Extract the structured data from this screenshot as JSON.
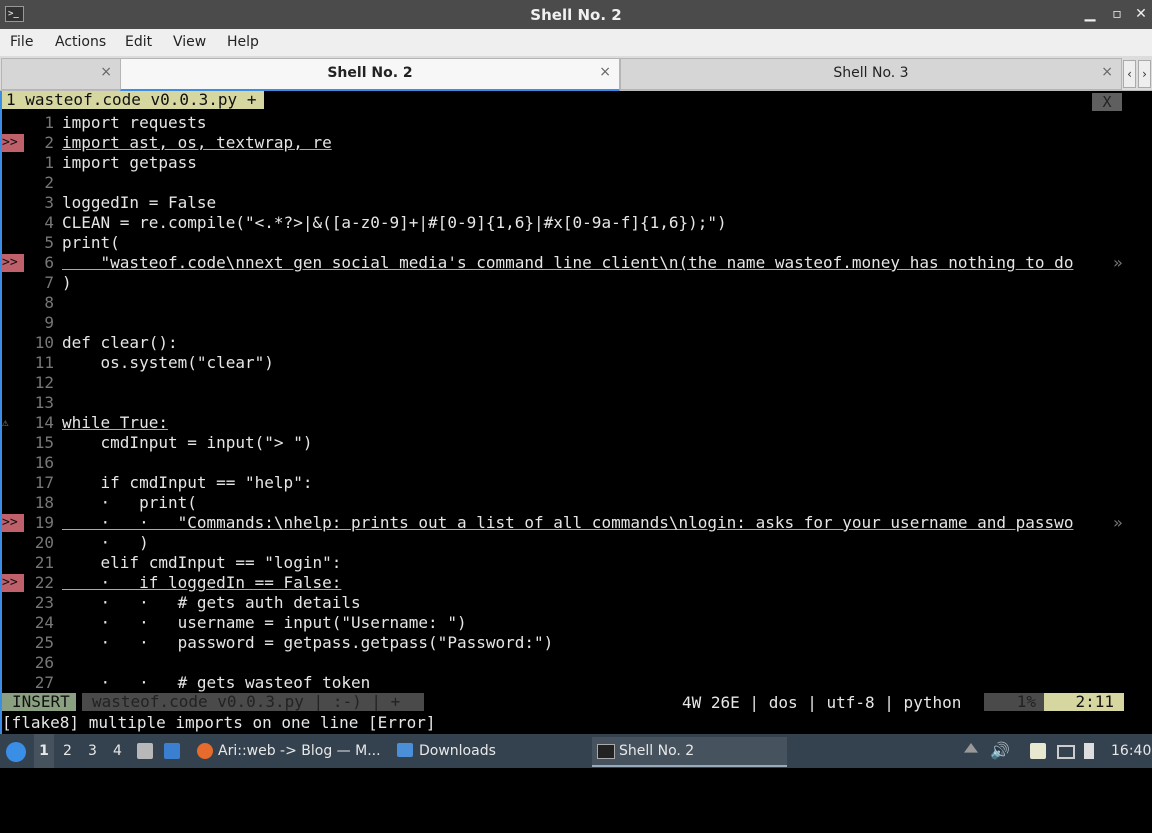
{
  "window": {
    "title": "Shell No. 2",
    "icon": "terminal-icon"
  },
  "menu": [
    "File",
    "Actions",
    "Edit",
    "View",
    "Help"
  ],
  "tabs": [
    {
      "label": "",
      "close": "×"
    },
    {
      "label": "Shell No. 2",
      "close": "×"
    },
    {
      "label": "Shell No. 3",
      "close": "×"
    }
  ],
  "tab_nav": {
    "prev": "‹",
    "next": "›"
  },
  "vim": {
    "tab_label": "1 wasteof.code v0.0.3.py +",
    "close_label": "X",
    "mode": "INSERT",
    "file": "wasteof.code v0.0.3.py | :-) | +",
    "status_right": "4W 26E | dos | utf-8 | python",
    "percent": "1%",
    "position": "2:11",
    "message": "[flake8] multiple imports on one line [Error]"
  },
  "code_lines": [
    {
      "num": "1",
      "sign": "",
      "text": "import requests"
    },
    {
      "num": "2",
      "sign": ">>",
      "text": "import ast, os, textwrap, re"
    },
    {
      "num": "1",
      "sign": "",
      "text": "import getpass"
    },
    {
      "num": "2",
      "sign": "",
      "text": ""
    },
    {
      "num": "3",
      "sign": "",
      "text": "loggedIn = False"
    },
    {
      "num": "4",
      "sign": "",
      "text": "CLEAN = re.compile(\"<.*?>|&([a-z0-9]+|#[0-9]{1,6}|#x[0-9a-f]{1,6});\")"
    },
    {
      "num": "5",
      "sign": "",
      "text": "print("
    },
    {
      "num": "6",
      "sign": ">>",
      "text": "    \"wasteof.code\\nnext gen social media's command line client\\n(the name wasteof.money has nothing to do"
    },
    {
      "num": "7",
      "sign": "",
      "text": ")"
    },
    {
      "num": "8",
      "sign": "",
      "text": ""
    },
    {
      "num": "9",
      "sign": "",
      "text": ""
    },
    {
      "num": "10",
      "sign": "",
      "text": "def clear():"
    },
    {
      "num": "11",
      "sign": "",
      "text": "    os.system(\"clear\")"
    },
    {
      "num": "12",
      "sign": "",
      "text": ""
    },
    {
      "num": "13",
      "sign": "",
      "text": ""
    },
    {
      "num": "14",
      "sign": "⚠",
      "text": "while True:"
    },
    {
      "num": "15",
      "sign": "",
      "text": "    cmdInput = input(\"> \")"
    },
    {
      "num": "16",
      "sign": "",
      "text": ""
    },
    {
      "num": "17",
      "sign": "",
      "text": "    if cmdInput == \"help\":"
    },
    {
      "num": "18",
      "sign": "",
      "text": "    ·   print("
    },
    {
      "num": "19",
      "sign": ">>",
      "text": "    ·   ·   \"Commands:\\nhelp: prints out a list of all commands\\nlogin: asks for your username and passwo"
    },
    {
      "num": "20",
      "sign": "",
      "text": "    ·   )"
    },
    {
      "num": "21",
      "sign": "",
      "text": "    elif cmdInput == \"login\":"
    },
    {
      "num": "22",
      "sign": ">>",
      "text": "    ·   if loggedIn == False:"
    },
    {
      "num": "23",
      "sign": "",
      "text": "    ·   ·   # gets auth details"
    },
    {
      "num": "24",
      "sign": "",
      "text": "    ·   ·   username = input(\"Username: \")"
    },
    {
      "num": "25",
      "sign": "",
      "text": "    ·   ·   password = getpass.getpass(\"Password:\")"
    },
    {
      "num": "26",
      "sign": "",
      "text": ""
    },
    {
      "num": "27",
      "sign": "",
      "text": "    ·   ·   # gets wasteof token"
    }
  ],
  "taskbar": {
    "workspaces": [
      "1",
      "2",
      "3",
      "4"
    ],
    "tasks": [
      {
        "label": "Ari::web -> Blog — M...",
        "icon": "firefox-icon"
      },
      {
        "label": "Downloads",
        "icon": "folder-icon"
      },
      {
        "label": "Shell No. 2",
        "icon": "terminal-icon"
      }
    ],
    "clock": "16:40"
  },
  "colors": {
    "accent": "#3a8ee6",
    "error_sign": "#c0606a",
    "vim_tab": "#d6d6a0",
    "taskbar": "#34414e"
  }
}
